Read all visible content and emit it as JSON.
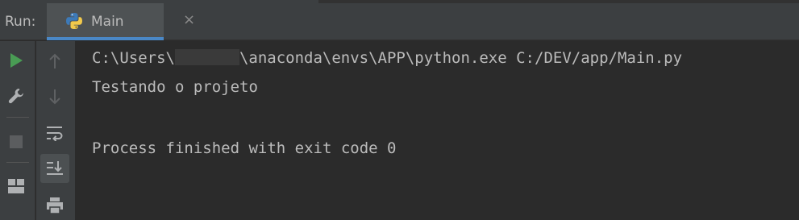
{
  "run_panel": {
    "run_label": "Run:",
    "tab": {
      "title": "Main",
      "close_glyph": "×",
      "icon": "python-icon"
    }
  },
  "toolbar_left": [
    {
      "name": "rerun-icon",
      "color": "#499c54"
    },
    {
      "name": "wrench-icon"
    },
    {
      "name": "stop-icon"
    },
    {
      "name": "layout-icon"
    }
  ],
  "toolbar_right": [
    {
      "name": "arrow-up-icon"
    },
    {
      "name": "arrow-down-icon"
    },
    {
      "name": "soft-wrap-icon"
    },
    {
      "name": "scroll-to-end-icon"
    },
    {
      "name": "print-icon"
    }
  ],
  "console": {
    "line1_prefix": "C:\\Users\\",
    "line1_redacted": "",
    "line1_suffix": "\\anaconda\\envs\\APP\\python.exe C:/DEV/app/Main.py",
    "line2": "Testando o projeto",
    "line3": "",
    "line4": "Process finished with exit code 0"
  },
  "colors": {
    "background": "#2b2b2b",
    "panel": "#3c3f41",
    "tab_active": "#4e5254",
    "accent": "#4a88c7",
    "text": "#bbbbbb",
    "run_green": "#499c54"
  }
}
